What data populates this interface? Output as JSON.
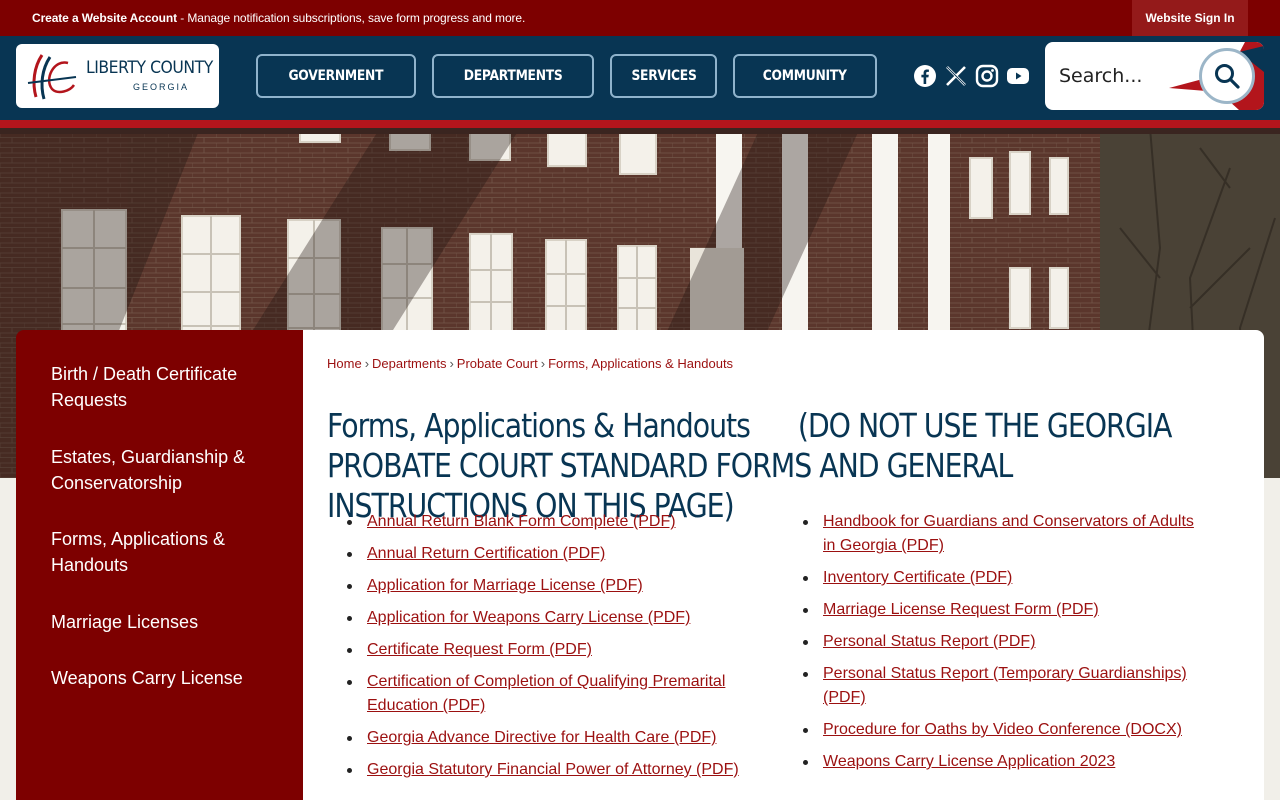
{
  "topbar": {
    "account_bold": "Create a Website Account",
    "account_rest": " - Manage notification subscriptions, save form progress and more.",
    "signin": "Website Sign In"
  },
  "logo": {
    "name": "LIBERTY COUNTY",
    "state": "GEORGIA"
  },
  "nav": [
    "GOVERNMENT",
    "DEPARTMENTS",
    "SERVICES",
    "COMMUNITY"
  ],
  "social": [
    "facebook-icon",
    "x-icon",
    "instagram-icon",
    "youtube-icon"
  ],
  "search": {
    "placeholder": "Search..."
  },
  "sidebar": [
    "Birth / Death Certificate Requests",
    "Estates, Guardianship & Conservatorship",
    "Forms, Applications & Handouts",
    "Marriage Licenses",
    "Weapons Carry License"
  ],
  "breadcrumb": [
    "Home",
    "Departments",
    "Probate Court",
    "Forms, Applications & Handouts"
  ],
  "page_title": "Forms, Applications & Handouts      (DO NOT USE THE GEORGIA PROBATE COURT STANDARD FORMS AND GENERAL INSTRUCTIONS ON THIS PAGE)",
  "links_left": [
    "Annual Return Blank Form Complete (PDF)",
    "Annual Return Certification (PDF)",
    "Application for Marriage License (PDF)",
    "Application for Weapons Carry License (PDF)",
    "Certificate Request Form (PDF)",
    "Certification of Completion of Qualifying Premarital Education (PDF)",
    "Georgia Advance Directive for Health Care (PDF)",
    "Georgia Statutory Financial Power of Attorney (PDF)"
  ],
  "links_right": [
    "Handbook for Guardians and Conservators of Adults in Georgia (PDF)",
    "Inventory Certificate (PDF)",
    "Marriage License Request Form (PDF)",
    "Personal Status Report (PDF)",
    "Personal Status Report (Temporary Guardianships) (PDF)",
    "Procedure for Oaths by Video Conference (DOCX)",
    "Weapons Carry License Application 2023"
  ],
  "colors": {
    "maroon": "#7d0000",
    "navy": "#083553",
    "red_accent": "#b3151c",
    "link": "#9b1010"
  }
}
